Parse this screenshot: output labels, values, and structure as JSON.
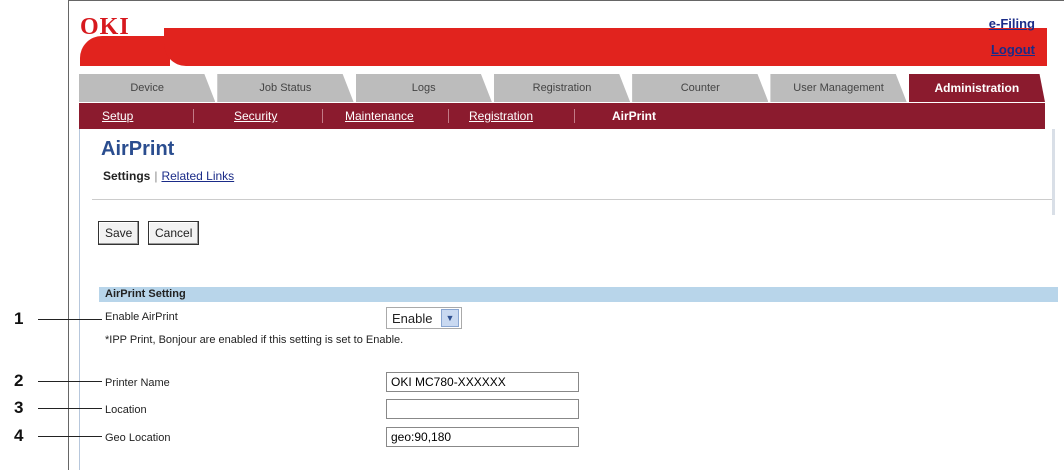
{
  "header": {
    "logo_text": "OKI",
    "links": [
      "e-Filing",
      "Logout"
    ]
  },
  "tabs": [
    {
      "label": "Device"
    },
    {
      "label": "Job Status"
    },
    {
      "label": "Logs"
    },
    {
      "label": "Registration"
    },
    {
      "label": "Counter"
    },
    {
      "label": "User Management"
    },
    {
      "label": "Administration",
      "active": true
    }
  ],
  "subnav": {
    "items": [
      "Setup",
      "Security",
      "Maintenance",
      "Registration",
      "AirPrint"
    ],
    "current": "AirPrint"
  },
  "page": {
    "title": "AirPrint",
    "tab_settings": "Settings",
    "tab_related": "Related Links"
  },
  "buttons": {
    "save": "Save",
    "cancel": "Cancel"
  },
  "section": {
    "title": "AirPrint Setting"
  },
  "fields": {
    "enable_label": "Enable AirPrint",
    "enable_value": "Enable",
    "note": "*IPP Print, Bonjour are enabled if this setting is set to Enable.",
    "printer_name_label": "Printer Name",
    "printer_name_value": "OKI MC780-XXXXXX",
    "location_label": "Location",
    "location_value": "",
    "geo_label": "Geo Location",
    "geo_value": "geo:90,180"
  },
  "callouts": [
    "1",
    "2",
    "3",
    "4"
  ],
  "colors": {
    "brand_red": "#e1231e",
    "nav_maroon": "#8b1b2e",
    "section_blue": "#b8d5ea",
    "title_blue": "#2a4d8f"
  },
  "icons": {
    "select_arrow": "chevron-down-icon"
  }
}
